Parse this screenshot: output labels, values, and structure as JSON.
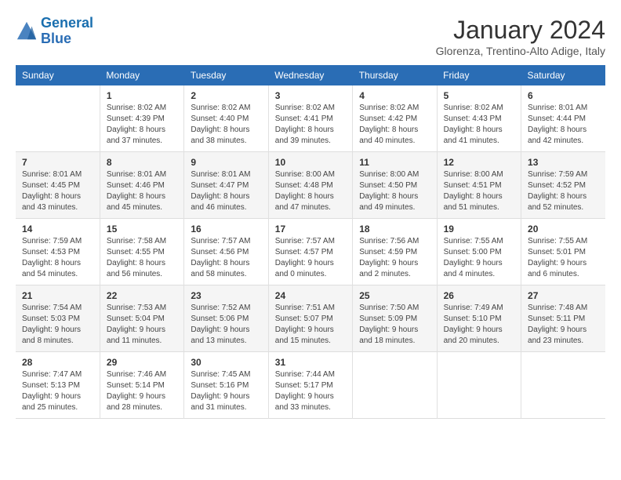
{
  "header": {
    "logo_line1": "General",
    "logo_line2": "Blue",
    "month": "January 2024",
    "location": "Glorenza, Trentino-Alto Adige, Italy"
  },
  "days_of_week": [
    "Sunday",
    "Monday",
    "Tuesday",
    "Wednesday",
    "Thursday",
    "Friday",
    "Saturday"
  ],
  "weeks": [
    [
      {
        "day": "",
        "info": ""
      },
      {
        "day": "1",
        "info": "Sunrise: 8:02 AM\nSunset: 4:39 PM\nDaylight: 8 hours\nand 37 minutes."
      },
      {
        "day": "2",
        "info": "Sunrise: 8:02 AM\nSunset: 4:40 PM\nDaylight: 8 hours\nand 38 minutes."
      },
      {
        "day": "3",
        "info": "Sunrise: 8:02 AM\nSunset: 4:41 PM\nDaylight: 8 hours\nand 39 minutes."
      },
      {
        "day": "4",
        "info": "Sunrise: 8:02 AM\nSunset: 4:42 PM\nDaylight: 8 hours\nand 40 minutes."
      },
      {
        "day": "5",
        "info": "Sunrise: 8:02 AM\nSunset: 4:43 PM\nDaylight: 8 hours\nand 41 minutes."
      },
      {
        "day": "6",
        "info": "Sunrise: 8:01 AM\nSunset: 4:44 PM\nDaylight: 8 hours\nand 42 minutes."
      }
    ],
    [
      {
        "day": "7",
        "info": "Sunrise: 8:01 AM\nSunset: 4:45 PM\nDaylight: 8 hours\nand 43 minutes."
      },
      {
        "day": "8",
        "info": "Sunrise: 8:01 AM\nSunset: 4:46 PM\nDaylight: 8 hours\nand 45 minutes."
      },
      {
        "day": "9",
        "info": "Sunrise: 8:01 AM\nSunset: 4:47 PM\nDaylight: 8 hours\nand 46 minutes."
      },
      {
        "day": "10",
        "info": "Sunrise: 8:00 AM\nSunset: 4:48 PM\nDaylight: 8 hours\nand 47 minutes."
      },
      {
        "day": "11",
        "info": "Sunrise: 8:00 AM\nSunset: 4:50 PM\nDaylight: 8 hours\nand 49 minutes."
      },
      {
        "day": "12",
        "info": "Sunrise: 8:00 AM\nSunset: 4:51 PM\nDaylight: 8 hours\nand 51 minutes."
      },
      {
        "day": "13",
        "info": "Sunrise: 7:59 AM\nSunset: 4:52 PM\nDaylight: 8 hours\nand 52 minutes."
      }
    ],
    [
      {
        "day": "14",
        "info": "Sunrise: 7:59 AM\nSunset: 4:53 PM\nDaylight: 8 hours\nand 54 minutes."
      },
      {
        "day": "15",
        "info": "Sunrise: 7:58 AM\nSunset: 4:55 PM\nDaylight: 8 hours\nand 56 minutes."
      },
      {
        "day": "16",
        "info": "Sunrise: 7:57 AM\nSunset: 4:56 PM\nDaylight: 8 hours\nand 58 minutes."
      },
      {
        "day": "17",
        "info": "Sunrise: 7:57 AM\nSunset: 4:57 PM\nDaylight: 9 hours\nand 0 minutes."
      },
      {
        "day": "18",
        "info": "Sunrise: 7:56 AM\nSunset: 4:59 PM\nDaylight: 9 hours\nand 2 minutes."
      },
      {
        "day": "19",
        "info": "Sunrise: 7:55 AM\nSunset: 5:00 PM\nDaylight: 9 hours\nand 4 minutes."
      },
      {
        "day": "20",
        "info": "Sunrise: 7:55 AM\nSunset: 5:01 PM\nDaylight: 9 hours\nand 6 minutes."
      }
    ],
    [
      {
        "day": "21",
        "info": "Sunrise: 7:54 AM\nSunset: 5:03 PM\nDaylight: 9 hours\nand 8 minutes."
      },
      {
        "day": "22",
        "info": "Sunrise: 7:53 AM\nSunset: 5:04 PM\nDaylight: 9 hours\nand 11 minutes."
      },
      {
        "day": "23",
        "info": "Sunrise: 7:52 AM\nSunset: 5:06 PM\nDaylight: 9 hours\nand 13 minutes."
      },
      {
        "day": "24",
        "info": "Sunrise: 7:51 AM\nSunset: 5:07 PM\nDaylight: 9 hours\nand 15 minutes."
      },
      {
        "day": "25",
        "info": "Sunrise: 7:50 AM\nSunset: 5:09 PM\nDaylight: 9 hours\nand 18 minutes."
      },
      {
        "day": "26",
        "info": "Sunrise: 7:49 AM\nSunset: 5:10 PM\nDaylight: 9 hours\nand 20 minutes."
      },
      {
        "day": "27",
        "info": "Sunrise: 7:48 AM\nSunset: 5:11 PM\nDaylight: 9 hours\nand 23 minutes."
      }
    ],
    [
      {
        "day": "28",
        "info": "Sunrise: 7:47 AM\nSunset: 5:13 PM\nDaylight: 9 hours\nand 25 minutes."
      },
      {
        "day": "29",
        "info": "Sunrise: 7:46 AM\nSunset: 5:14 PM\nDaylight: 9 hours\nand 28 minutes."
      },
      {
        "day": "30",
        "info": "Sunrise: 7:45 AM\nSunset: 5:16 PM\nDaylight: 9 hours\nand 31 minutes."
      },
      {
        "day": "31",
        "info": "Sunrise: 7:44 AM\nSunset: 5:17 PM\nDaylight: 9 hours\nand 33 minutes."
      },
      {
        "day": "",
        "info": ""
      },
      {
        "day": "",
        "info": ""
      },
      {
        "day": "",
        "info": ""
      }
    ]
  ]
}
